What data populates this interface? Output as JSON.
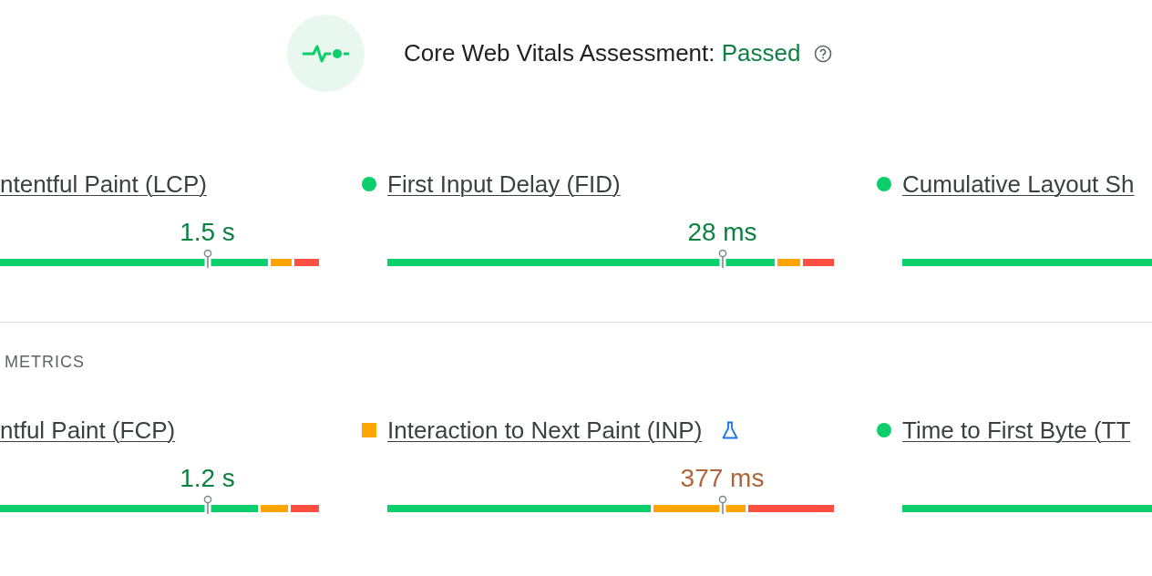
{
  "assessment": {
    "label": "Core Web Vitals Assessment:",
    "result": "Passed"
  },
  "core_metrics": [
    {
      "title": "ntentful Paint (LCP)",
      "kind": "good",
      "value": "1.5 s",
      "level": 0.65
    },
    {
      "title": "First Input Delay (FID)",
      "kind": "good",
      "value": "28 ms",
      "level": 0.75
    },
    {
      "title": "Cumulative Layout Sh",
      "kind": "good"
    }
  ],
  "other_section": {
    "label": "METRICS"
  },
  "other_metrics": [
    {
      "title": "ntful Paint (FCP)",
      "kind": "good",
      "value": "1.2 s",
      "level": 0.65
    },
    {
      "title": "Interaction to Next Paint (INP)",
      "kind": "needs-improvement",
      "experimental": true,
      "value": "377 ms",
      "level": 0.75
    },
    {
      "title": "Time to First Byte (TT",
      "kind": "good"
    }
  ]
}
